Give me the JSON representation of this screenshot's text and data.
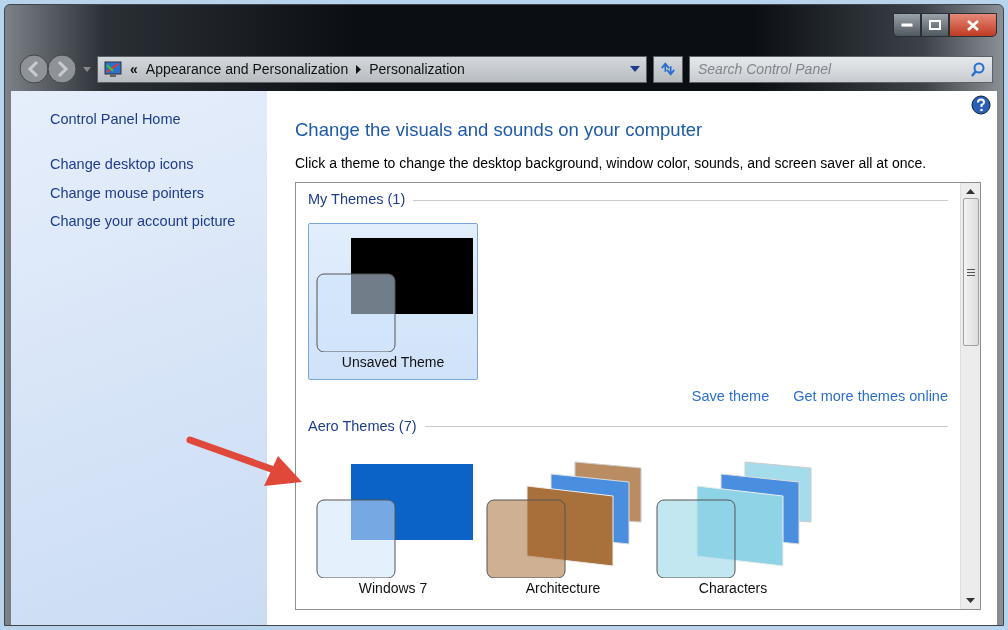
{
  "navigation": {
    "overflow": "«",
    "breadcrumb": [
      "Appearance and Personalization",
      "Personalization"
    ],
    "search": {
      "placeholder": "Search Control Panel"
    }
  },
  "sidebar": {
    "home": "Control Panel Home",
    "links": [
      "Change desktop icons",
      "Change mouse pointers",
      "Change your account picture"
    ]
  },
  "main": {
    "heading": "Change the visuals and sounds on your computer",
    "description": "Click a theme to change the desktop background, window color, sounds, and screen saver all at once.",
    "groups": [
      {
        "title": "My Themes (1)",
        "themes": [
          {
            "name": "Unsaved Theme",
            "kind": "single",
            "color": "#000000",
            "selected": true
          }
        ],
        "links": [
          "Save theme",
          "Get more themes online"
        ]
      },
      {
        "title": "Aero Themes (7)",
        "themes": [
          {
            "name": "Windows 7",
            "kind": "single",
            "color": "#0b63c8",
            "selected": false
          },
          {
            "name": "Architecture",
            "kind": "stack",
            "color": "#a8703a",
            "selected": false
          },
          {
            "name": "Characters",
            "kind": "stack",
            "color": "#8fd3e6",
            "selected": false
          }
        ]
      }
    ]
  }
}
